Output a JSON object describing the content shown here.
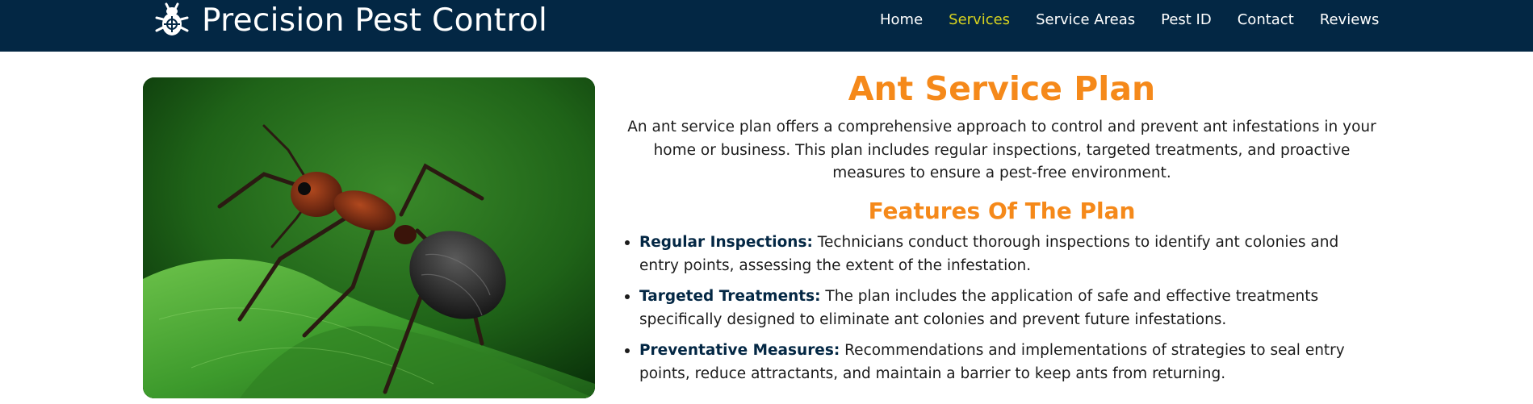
{
  "header": {
    "logo_icon": "bug-icon",
    "brand_title": "Precision Pest Control",
    "nav": [
      {
        "label": "Home",
        "active": false
      },
      {
        "label": "Services",
        "active": true
      },
      {
        "label": "Service Areas",
        "active": false
      },
      {
        "label": "Pest ID",
        "active": false
      },
      {
        "label": "Contact",
        "active": false
      },
      {
        "label": "Reviews",
        "active": false
      }
    ]
  },
  "main": {
    "image": {
      "subject": "ant-on-leaf-photo"
    },
    "title": "Ant Service Plan",
    "intro": "An ant service plan offers a comprehensive approach to control and prevent ant infestations in your home or business. This plan includes regular inspections, targeted treatments, and proactive measures to ensure a pest-free environment.",
    "features_title": "Features Of The Plan",
    "features": [
      {
        "label": "Regular Inspections:",
        "text": " Technicians conduct thorough inspections to identify ant colonies and entry points, assessing the extent of the infestation."
      },
      {
        "label": "Targeted Treatments:",
        "text": " The plan includes the application of safe and effective treatments specifically designed to eliminate ant colonies and prevent future infestations."
      },
      {
        "label": "Preventative Measures:",
        "text": " Recommendations and implementations of strategies to seal entry points, reduce attractants, and maintain a barrier to keep ants from returning."
      }
    ]
  },
  "colors": {
    "header_bg": "#032744",
    "accent_orange": "#f5891a",
    "active_nav": "#d7d21f",
    "text": "#1c1c1c"
  }
}
